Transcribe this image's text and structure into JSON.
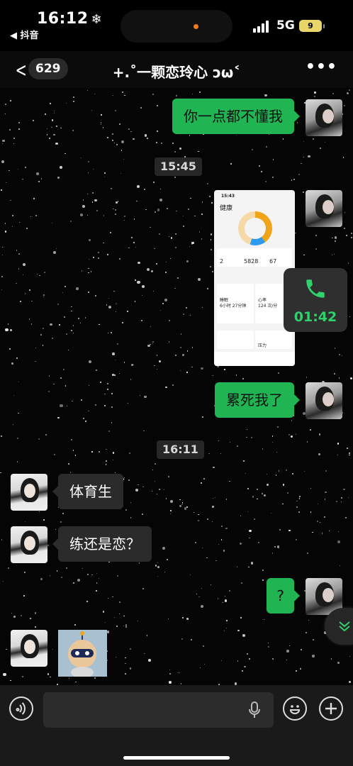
{
  "status_bar": {
    "time": "16:12",
    "weather_icon": "snowflake-icon",
    "back_app": "◀ 抖音",
    "network": "5G",
    "battery": "9"
  },
  "header": {
    "back_icon": "chevron-left-icon",
    "unread_count": "629",
    "title": "+.˚一颗恋玲心 ͻω˂",
    "more_icon": "more-dots-icon"
  },
  "messages": [
    {
      "side": "out",
      "type": "text",
      "text": "你一点都不懂我"
    },
    {
      "type": "timestamp",
      "text": "15:45"
    },
    {
      "side": "out",
      "type": "image",
      "description": "health app screenshot"
    },
    {
      "side": "out",
      "type": "text",
      "text": "累死我了"
    },
    {
      "type": "timestamp",
      "text": "16:11"
    },
    {
      "side": "in",
      "type": "text",
      "text": "体育生"
    },
    {
      "side": "in",
      "type": "text",
      "text": "练还是恋？"
    },
    {
      "side": "out",
      "type": "text",
      "text": "?"
    },
    {
      "side": "in",
      "type": "sticker",
      "description": "robot sticker"
    }
  ],
  "health_shot": {
    "status_time": "15:43",
    "app_title": "健康",
    "stats": [
      "2",
      "5828",
      "67"
    ],
    "sleep_label": "睡眠",
    "sleep_value": "6小时 27分钟",
    "heart_label": "心率",
    "heart_value": "124 次/分",
    "stress_label": "压力"
  },
  "call_float": {
    "duration": "01:42",
    "icon": "phone-icon",
    "color": "#2fd26a"
  },
  "input_bar": {
    "voice_icon": "voice-mode-icon",
    "mic_icon": "microphone-icon",
    "emoji_icon": "emoji-icon",
    "plus_icon": "plus-icon"
  },
  "colors": {
    "out_bubble": "#21b453",
    "in_bubble": "#2b2b2b",
    "background": "#000000"
  }
}
